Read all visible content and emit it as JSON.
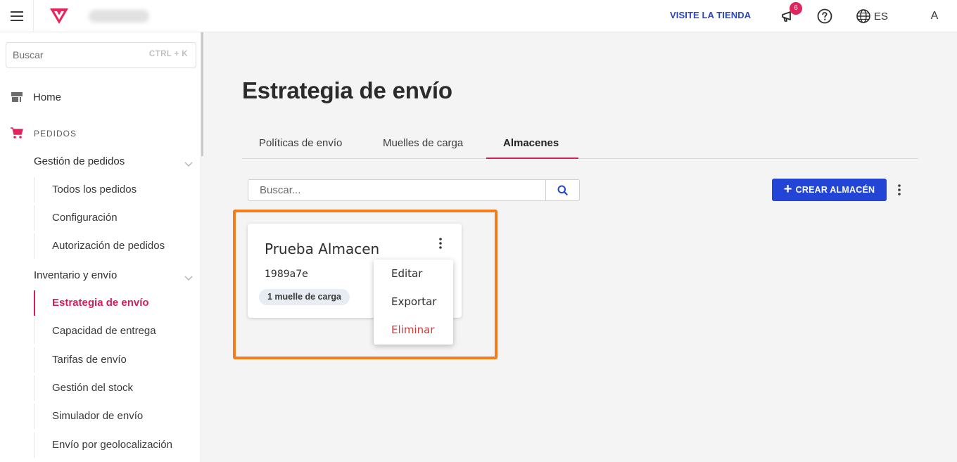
{
  "brand": {
    "accent": "#d21f5a",
    "primary": "#2345d5",
    "highlight": "#f57c1a"
  },
  "topbar": {
    "menu_icon": "hamburger-icon",
    "logo_icon": "vtex-logo-icon",
    "visit_store": "VISITE LA TIENDA",
    "notifications_count": "6",
    "notifications_icon": "megaphone-icon",
    "help_icon": "help-circle-icon",
    "language_icon": "globe-icon",
    "language": "ES",
    "avatar_initial": "A"
  },
  "sidebar": {
    "search_placeholder": "Buscar",
    "search_shortcut": "CTRL + K",
    "home": {
      "label": "Home",
      "icon": "store-icon"
    },
    "section": {
      "label": "PEDIDOS",
      "icon": "cart-icon"
    },
    "groups": [
      {
        "label": "Gestión de pedidos",
        "items": [
          "Todos los pedidos",
          "Configuración",
          "Autorización de pedidos"
        ]
      },
      {
        "label": "Inventario y envío",
        "items": [
          "Estrategia de envío",
          "Capacidad de entrega",
          "Tarifas de envío",
          "Gestión del stock",
          "Simulador de envío",
          "Envío por geolocalización"
        ]
      }
    ],
    "active_item": "Estrategia de envío"
  },
  "main": {
    "title": "Estrategia de envío",
    "tabs": [
      {
        "label": "Políticas de envío",
        "active": false
      },
      {
        "label": "Muelles de carga",
        "active": false
      },
      {
        "label": "Almacenes",
        "active": true
      }
    ],
    "search_placeholder": "Buscar...",
    "create_button": "CREAR ALMACÉN",
    "card": {
      "title": "Prueba Almacen",
      "code": "1989a7e",
      "badge": "1 muelle de carga"
    },
    "menu": {
      "items": [
        {
          "label": "Editar",
          "danger": false
        },
        {
          "label": "Exportar",
          "danger": false
        },
        {
          "label": "Eliminar",
          "danger": true
        }
      ]
    }
  }
}
